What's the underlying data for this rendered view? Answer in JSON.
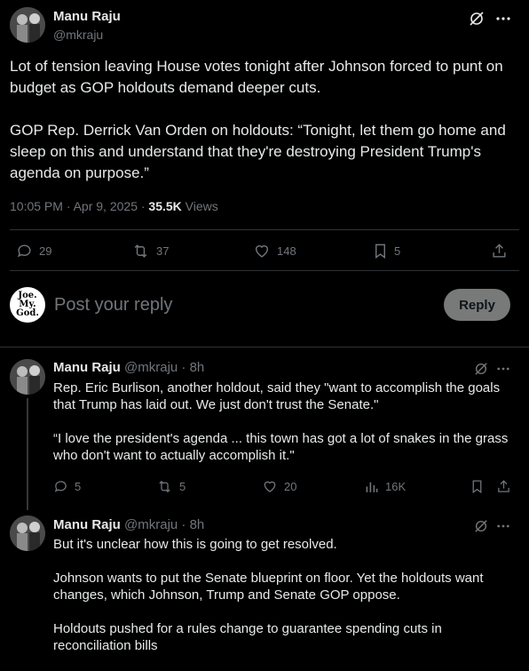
{
  "main_post": {
    "author_name": "Manu Raju",
    "author_handle": "@mkraju",
    "paragraph_1": "Lot of tension leaving House votes tonight after Johnson forced to punt on budget as GOP holdouts demand deeper cuts.",
    "paragraph_2": "GOP Rep. Derrick Van Orden on holdouts: “Tonight, let them go home and sleep on this and understand that they're destroying President Trump's agenda on purpose.”",
    "timestamp": "10:05 PM · Apr 9, 2025 · ",
    "views_count": "35.5K",
    "views_label": "Views",
    "replies": "29",
    "reposts": "37",
    "likes": "148",
    "bookmarks": "5"
  },
  "composer": {
    "avatar_text_1": "Joe.",
    "avatar_text_2": "My.",
    "avatar_text_3": "God.",
    "placeholder": "Post your reply",
    "button_label": "Reply"
  },
  "replies": [
    {
      "author_name": "Manu Raju",
      "author_handle": "@mkraju",
      "time": "· 8h",
      "paragraphs": [
        "Rep. Eric Burlison, another holdout, said they \"want to accomplish the goals that Trump has laid out. We just don't trust the Senate.\"",
        "“I love the president's agenda ... this town has got a lot of snakes in the grass who don't want to actually accomplish it.\""
      ],
      "replies": "5",
      "reposts": "5",
      "likes": "20",
      "views": "16K"
    },
    {
      "author_name": "Manu Raju",
      "author_handle": "@mkraju",
      "time": "· 8h",
      "paragraphs": [
        "But it's unclear how this is going to get resolved.",
        "Johnson wants to put the Senate blueprint on floor. Yet the holdouts want changes, which Johnson, Trump and Senate GOP oppose.",
        "Holdouts pushed for a rules change to guarantee spending cuts in reconciliation bills"
      ]
    }
  ],
  "colors": {
    "background": "#000000",
    "text": "#e7e9ea",
    "muted": "#71767b",
    "divider": "#2f3336",
    "reply_button_bg": "#787a7a"
  }
}
